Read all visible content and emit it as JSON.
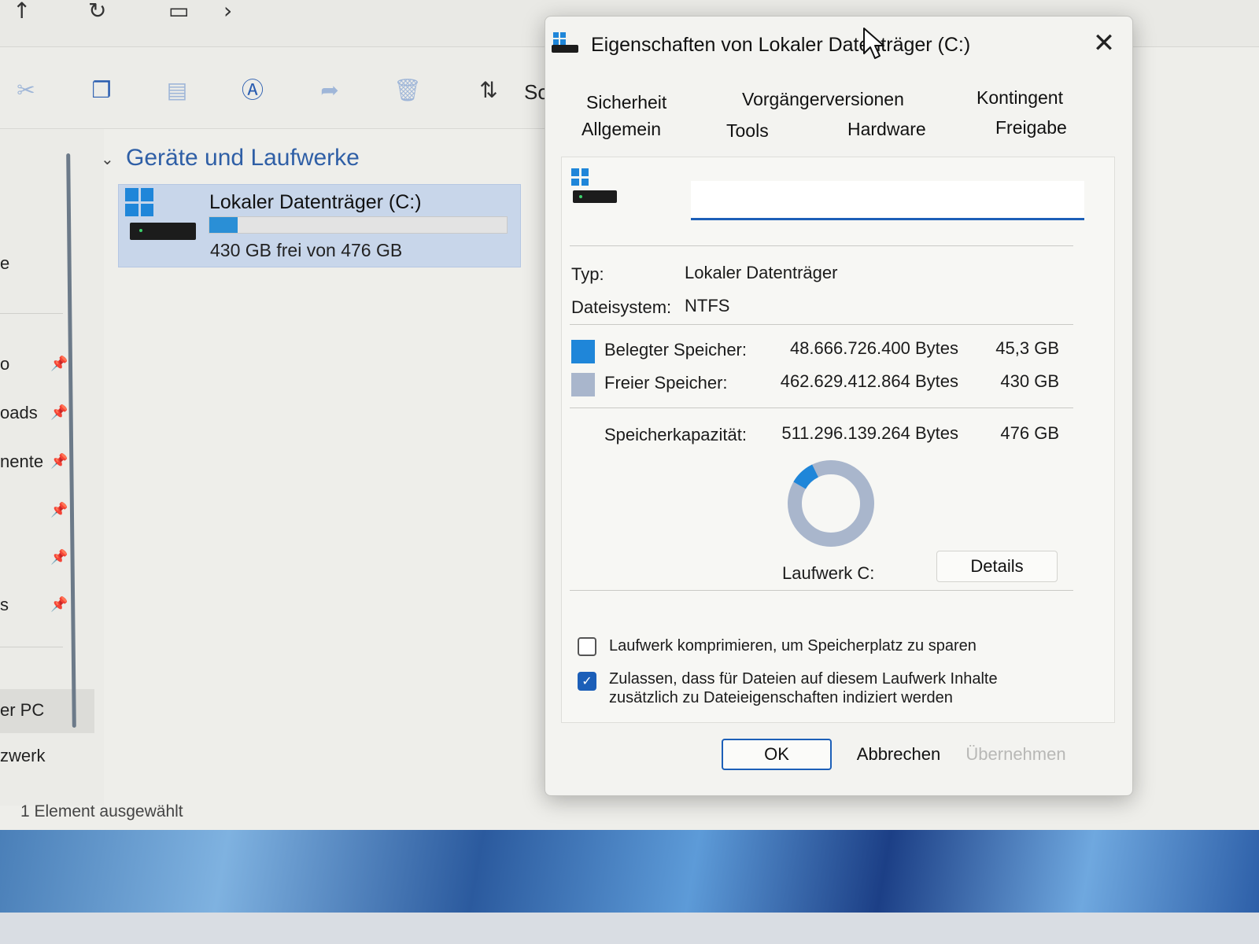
{
  "explorer": {
    "toolbar": {
      "sort_label": "So"
    },
    "nav": {
      "items": [
        {
          "label": "e"
        },
        {
          "label": "o"
        },
        {
          "label": "oads"
        },
        {
          "label": "nente"
        },
        {
          "label": "s"
        },
        {
          "label": "er PC"
        },
        {
          "label": "zwerk"
        }
      ]
    },
    "section_header": "Geräte und Laufwerke",
    "drive_tile": {
      "name": "Lokaler Datenträger (C:)",
      "free_text": "430 GB frei von 476 GB",
      "used_fraction": 0.095
    },
    "status_bar": "1 Element ausgewählt"
  },
  "dialog": {
    "title": "Eigenschaften von Lokaler Datenträger (C:)",
    "tabs_row1": [
      "Sicherheit",
      "Vorgängerversionen",
      "Kontingent"
    ],
    "tabs_row2": [
      "Allgemein",
      "Tools",
      "Hardware",
      "Freigabe"
    ],
    "active_tab": "Allgemein",
    "name_input": {
      "value": ""
    },
    "type_label": "Typ:",
    "type_value": "Lokaler Datenträger",
    "fs_label": "Dateisystem:",
    "fs_value": "NTFS",
    "used": {
      "label": "Belegter Speicher:",
      "bytes": "48.666.726.400 Bytes",
      "size": "45,3 GB"
    },
    "free": {
      "label": "Freier Speicher:",
      "bytes": "462.629.412.864 Bytes",
      "size": "430 GB"
    },
    "capacity": {
      "label": "Speicherkapazität:",
      "bytes": "511.296.139.264 Bytes",
      "size": "476 GB"
    },
    "used_fraction": 0.095,
    "drive_label": "Laufwerk C:",
    "details_label": "Details",
    "compress_label": "Laufwerk komprimieren, um Speicherplatz zu sparen",
    "compress_checked": false,
    "index_label_line1": "Zulassen, dass für Dateien auf diesem Laufwerk Inhalte",
    "index_label_line2": "zusätzlich zu Dateieigenschaften indiziert werden",
    "index_checked": true,
    "ok_label": "OK",
    "cancel_label": "Abbrechen",
    "apply_label": "Übernehmen"
  },
  "colors": {
    "used": "#1f86d9",
    "free": "#a9b6cc",
    "accent": "#1c5fb8"
  }
}
